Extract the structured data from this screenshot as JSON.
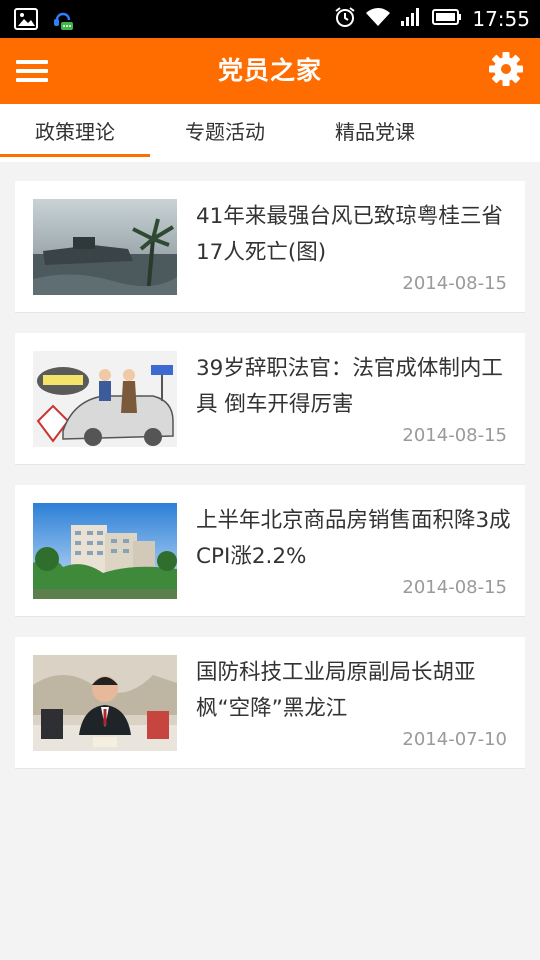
{
  "status_bar": {
    "time": "17:55",
    "icons": [
      "image-icon",
      "chat-icon",
      "alarm-icon",
      "wifi-icon",
      "signal-icon",
      "battery-icon"
    ]
  },
  "app_bar": {
    "title": "党员之家",
    "menu_icon": "hamburger-menu-icon",
    "settings_icon": "gear-icon",
    "color": "#ff6d00"
  },
  "tabs": [
    {
      "label": "政策理论",
      "active": true
    },
    {
      "label": "专题活动",
      "active": false
    },
    {
      "label": "精品党课",
      "active": false
    }
  ],
  "news": [
    {
      "title": "41年来最强台风已致琼粤桂三省17人死亡(图)",
      "date": "2014-08-15"
    },
    {
      "title": "39岁辞职法官：法官成体制内工具 倒车开得厉害",
      "date": "2014-08-15"
    },
    {
      "title": "上半年北京商品房销售面积降3成 CPI涨2.2%",
      "date": "2014-08-15"
    },
    {
      "title": "国防科技工业局原副局长胡亚枫“空降”黑龙江",
      "date": "2014-07-10"
    }
  ]
}
